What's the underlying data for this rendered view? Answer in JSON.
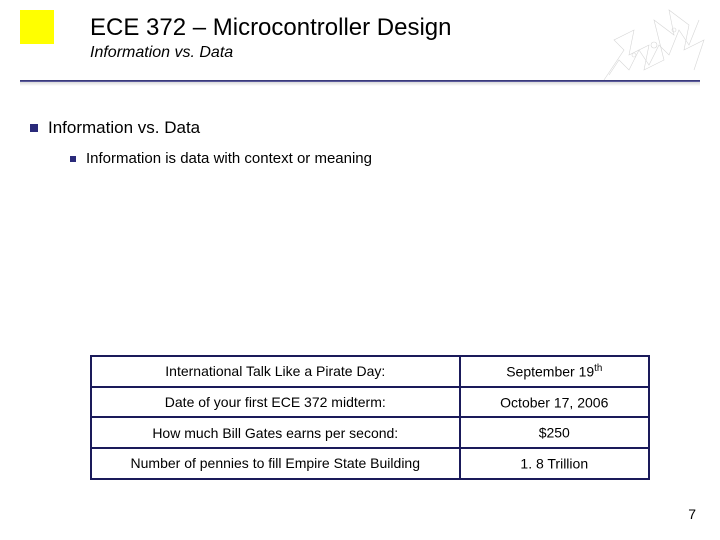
{
  "header": {
    "title": "ECE 372 – Microcontroller Design",
    "subtitle": "Information vs. Data"
  },
  "bullets": {
    "level1": "Information vs. Data",
    "level2": "Information is data with context or meaning"
  },
  "table": {
    "rows": [
      {
        "label": "International Talk Like a Pirate Day:",
        "value": "September 19",
        "value_sup": "th"
      },
      {
        "label": "Date of your first ECE 372 midterm:",
        "value": "October 17, 2006",
        "value_sup": ""
      },
      {
        "label": "How much Bill Gates earns per second:",
        "value": "$250",
        "value_sup": ""
      },
      {
        "label": "Number of pennies to fill Empire State Building",
        "value": "1. 8 Trillion",
        "value_sup": ""
      }
    ]
  },
  "page_number": "7"
}
